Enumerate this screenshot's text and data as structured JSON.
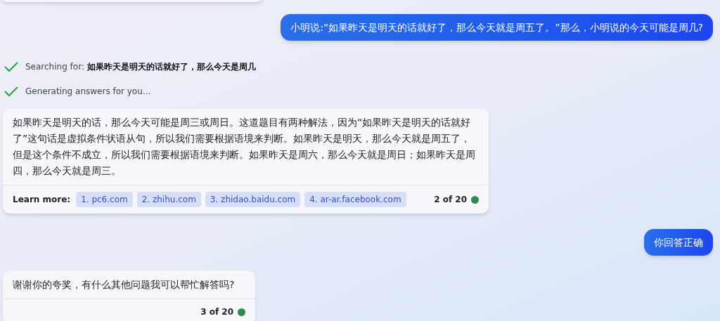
{
  "messages": [
    {
      "kind": "user",
      "text": "小明说:“如果昨天是明天的话就好了，那么今天就是周五了。”那么，小明说的今天可能是周几?"
    },
    {
      "kind": "steps",
      "items": [
        {
          "label": "Searching for: ",
          "query": "如果昨天是明天的话就好了，那么今天是周几",
          "done": true
        },
        {
          "label": "Generating answers for you…",
          "done": true
        }
      ]
    },
    {
      "kind": "bot",
      "text": "如果昨天是明天的话，那么今天可能是周三或周日。这道题目有两种解法，因为“如果昨天是明天的话就好了”这句话是虚拟条件状语从句，所以我们需要根据语境来判断。如果昨天是明天，那么今天就是周五了，但是这个条件不成立，所以我们需要根据语境来判断。如果昨天是周六，那么今天就是周日；如果昨天是周四，那么今天就是周三。",
      "learn_more_label": "Learn more:",
      "links": [
        "1. pc6.com",
        "2. zhihu.com",
        "3. zhidao.baidu.com",
        "4. ar-ar.facebook.com"
      ],
      "count": "2 of 20",
      "color": "#2e8b4a"
    },
    {
      "kind": "user",
      "text": "你回答正确"
    },
    {
      "kind": "bot",
      "text": "谢谢你的夸奖，有什么其他问题我可以帮忙解答吗?",
      "count": "3 of 20",
      "color": "#2e8b4a"
    }
  ]
}
